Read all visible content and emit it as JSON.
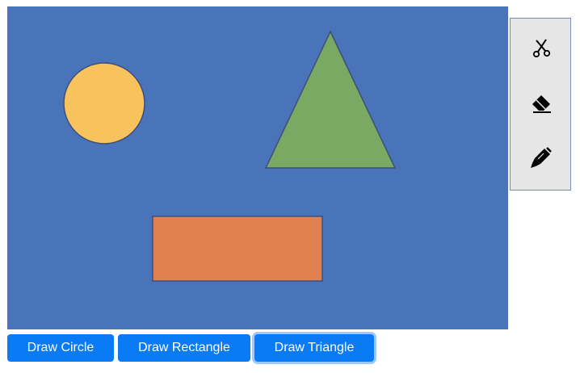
{
  "canvas": {
    "background": "#4a74b9",
    "shapes": [
      {
        "type": "circle",
        "fill": "#f8c25c",
        "stroke": "#3d4f7a"
      },
      {
        "type": "triangle",
        "fill": "#7aa963",
        "stroke": "#3d4f7a"
      },
      {
        "type": "rectangle",
        "fill": "#e18152",
        "stroke": "#3d4f7a"
      }
    ]
  },
  "toolbox": {
    "tools": [
      {
        "name": "scissors-icon"
      },
      {
        "name": "eraser-icon"
      },
      {
        "name": "marker-icon"
      }
    ]
  },
  "buttons": {
    "draw_circle": "Draw Circle",
    "draw_rectangle": "Draw Rectangle",
    "draw_triangle": "Draw Triangle",
    "active": "draw_triangle",
    "color": "#0a7bf5"
  }
}
